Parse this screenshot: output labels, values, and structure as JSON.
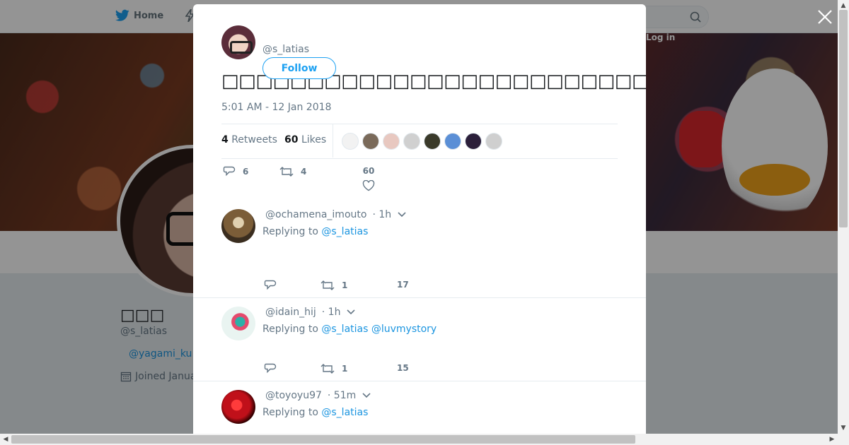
{
  "nav": {
    "home_label": "Home",
    "lang_label": "Log in"
  },
  "profile": {
    "name": "□□□",
    "handle": "@s_latias",
    "link": "@yagami_ku",
    "joined": "Joined Janua"
  },
  "tweet": {
    "author_handle": "@s_latias",
    "follow_label": "Follow",
    "text": "□□□□□□□□□□□□□□□□□□□□□□□□□□□□□□□□□□□□□□□□□□□□□□□□□□□□□□",
    "timestamp": "5:01 AM - 12 Jan 2018",
    "retweets_count": "4",
    "retweets_label": "Retweets",
    "likes_count": "60",
    "likes_label": "Likes",
    "liker_avatar_colors": [
      "#f2f2f2",
      "#7a6a5a",
      "#e8c8c0",
      "#d0d0d0",
      "#3a3a2a",
      "#5b8fd6",
      "#2b1f3a",
      "#cfcfcf"
    ],
    "reply_count": "6",
    "retweet_count": "4",
    "like_count": "60"
  },
  "replies": [
    {
      "handle": "@ochamena_imouto",
      "time": "· 1h",
      "replying_prefix": "Replying to",
      "mentions": "@s_latias",
      "reply_count": "",
      "retweet_count": "1",
      "like_count": "17",
      "avatar_color": "#6b5a3a"
    },
    {
      "handle": "@idain_hij",
      "time": "· 1h",
      "replying_prefix": "Replying to",
      "mentions": "@s_latias @luvmystory",
      "reply_count": "",
      "retweet_count": "1",
      "like_count": "15",
      "avatar_color": "#e9f4f1"
    },
    {
      "handle": "@toyoyu97",
      "time": "· 51m",
      "replying_prefix": "Replying to",
      "mentions": "@s_latias",
      "avatar_color": "#c0101a"
    }
  ],
  "icons": [
    "twitter-bird-icon",
    "lightning-icon",
    "search-icon",
    "close-icon",
    "calendar-icon",
    "reply-icon",
    "retweet-icon",
    "heart-icon",
    "chevron-down-icon"
  ]
}
